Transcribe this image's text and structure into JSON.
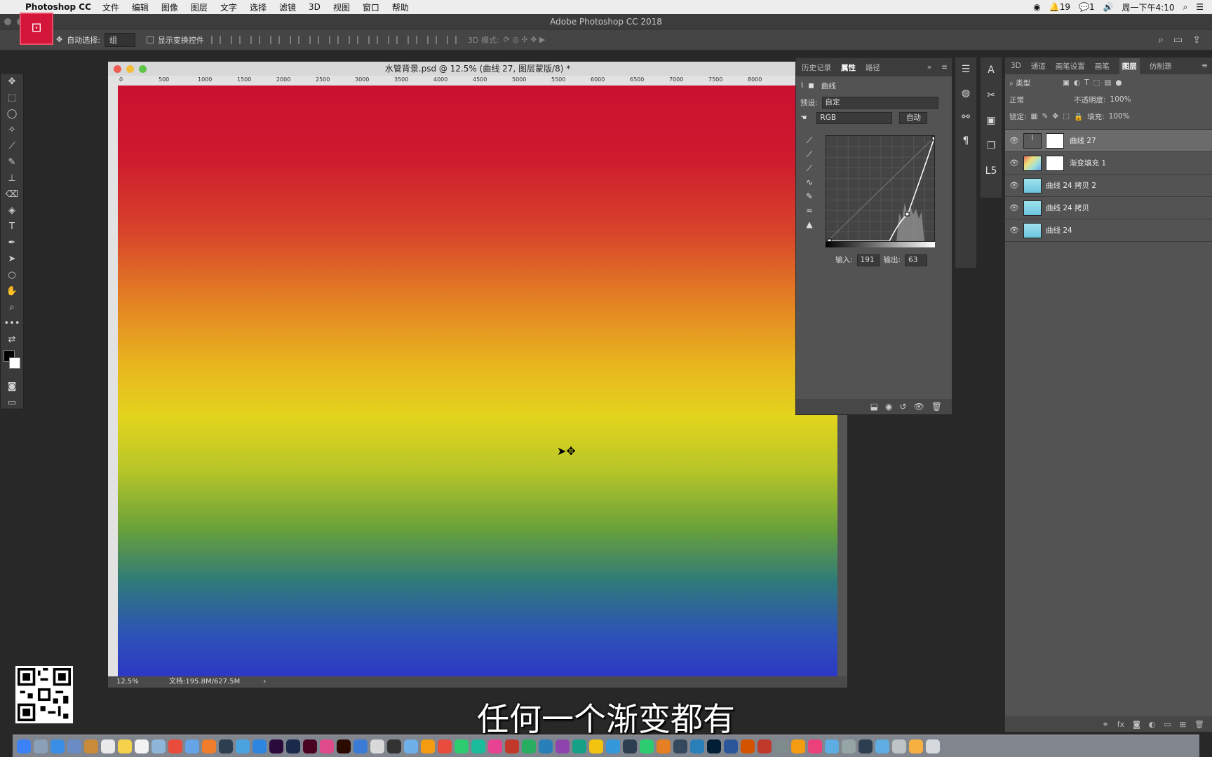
{
  "menubar": {
    "app_name": "Photoshop CC",
    "items": [
      "文件",
      "编辑",
      "图像",
      "图层",
      "文字",
      "选择",
      "滤镜",
      "3D",
      "视图",
      "窗口",
      "帮助"
    ],
    "status": {
      "notif_count": "19",
      "wechat_count": "1",
      "clock": "周一下午4:10"
    }
  },
  "window_title": "Adobe Photoshop CC 2018",
  "options_bar": {
    "auto_select_label": "自动选择:",
    "auto_select_value": "组",
    "show_transform_label": "显示变换控件",
    "mode_3d_label": "3D 模式:"
  },
  "document": {
    "title": "水管背景.psd @ 12.5% (曲线 27, 图层蒙版/8) *",
    "ruler_marks": [
      "0",
      "500",
      "1000",
      "1500",
      "2000",
      "2500",
      "3000",
      "3500",
      "4000",
      "4500",
      "5000",
      "5500",
      "6000",
      "6500",
      "7000",
      "7500",
      "8000"
    ],
    "zoom": "12.5%",
    "doc_info": "文档:195.8M/627.5M",
    "gradient_colors": [
      "#cb1030",
      "#e27a24",
      "#e3d41d",
      "#6aa13a",
      "#2d38c4"
    ]
  },
  "properties_panel": {
    "tabs": [
      "历史记录",
      "属性",
      "路径"
    ],
    "active_tab": "属性",
    "header": "曲线",
    "preset_label": "预设:",
    "preset_value": "自定",
    "channel": "RGB",
    "auto_button": "自动",
    "input_label": "输入:",
    "input_value": "191",
    "output_label": "输出:",
    "output_value": "63"
  },
  "layers_panel": {
    "tabs": [
      "3D",
      "通道",
      "画笔设置",
      "画笔",
      "图层",
      "仿制源"
    ],
    "active_tab": "图层",
    "filter_type": "类型",
    "blend_mode": "正常",
    "opacity_label": "不透明度:",
    "opacity_value": "100%",
    "lock_label": "锁定:",
    "fill_label": "填充:",
    "fill_value": "100%",
    "layers": [
      {
        "name": "曲线 27",
        "selected": true
      },
      {
        "name": "渐变填充 1",
        "selected": false
      },
      {
        "name": "曲线 24 拷贝 2",
        "selected": false
      },
      {
        "name": "曲线 24 拷贝",
        "selected": false
      },
      {
        "name": "曲线 24",
        "selected": false
      }
    ]
  },
  "subtitle": "任何一个渐变都有"
}
